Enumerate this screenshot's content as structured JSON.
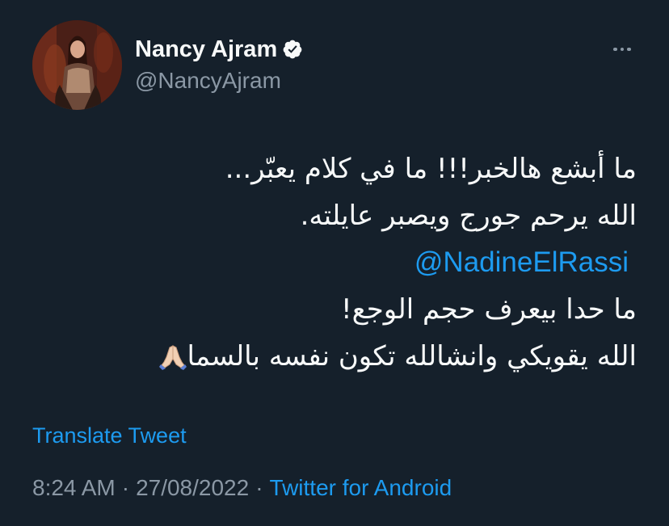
{
  "author": {
    "name": "Nancy Ajram",
    "handle": "@NancyAjram",
    "verified": true
  },
  "menu": {
    "icon": "more-horizontal-icon"
  },
  "tweet": {
    "line1": "ما أبشع هالخبر!!! ما في كلام يعبّر...",
    "line2": "الله يرحم جورج ويصبر عايلته.",
    "mention": "@NadineElRassi",
    "line4": "ما حدا بيعرف حجم الوجع!",
    "line5": "الله يقويكي وانشالله تكون نفسه بالسما",
    "line5_emoji": "folded-hands-icon"
  },
  "translate_label": "Translate Tweet",
  "meta": {
    "time": "8:24 AM",
    "separator": "·",
    "date": "27/08/2022",
    "source": "Twitter for Android"
  },
  "colors": {
    "background": "#15202b",
    "text": "#f7f9f9",
    "secondary_text": "#8b98a5",
    "link": "#1d9bf0"
  }
}
